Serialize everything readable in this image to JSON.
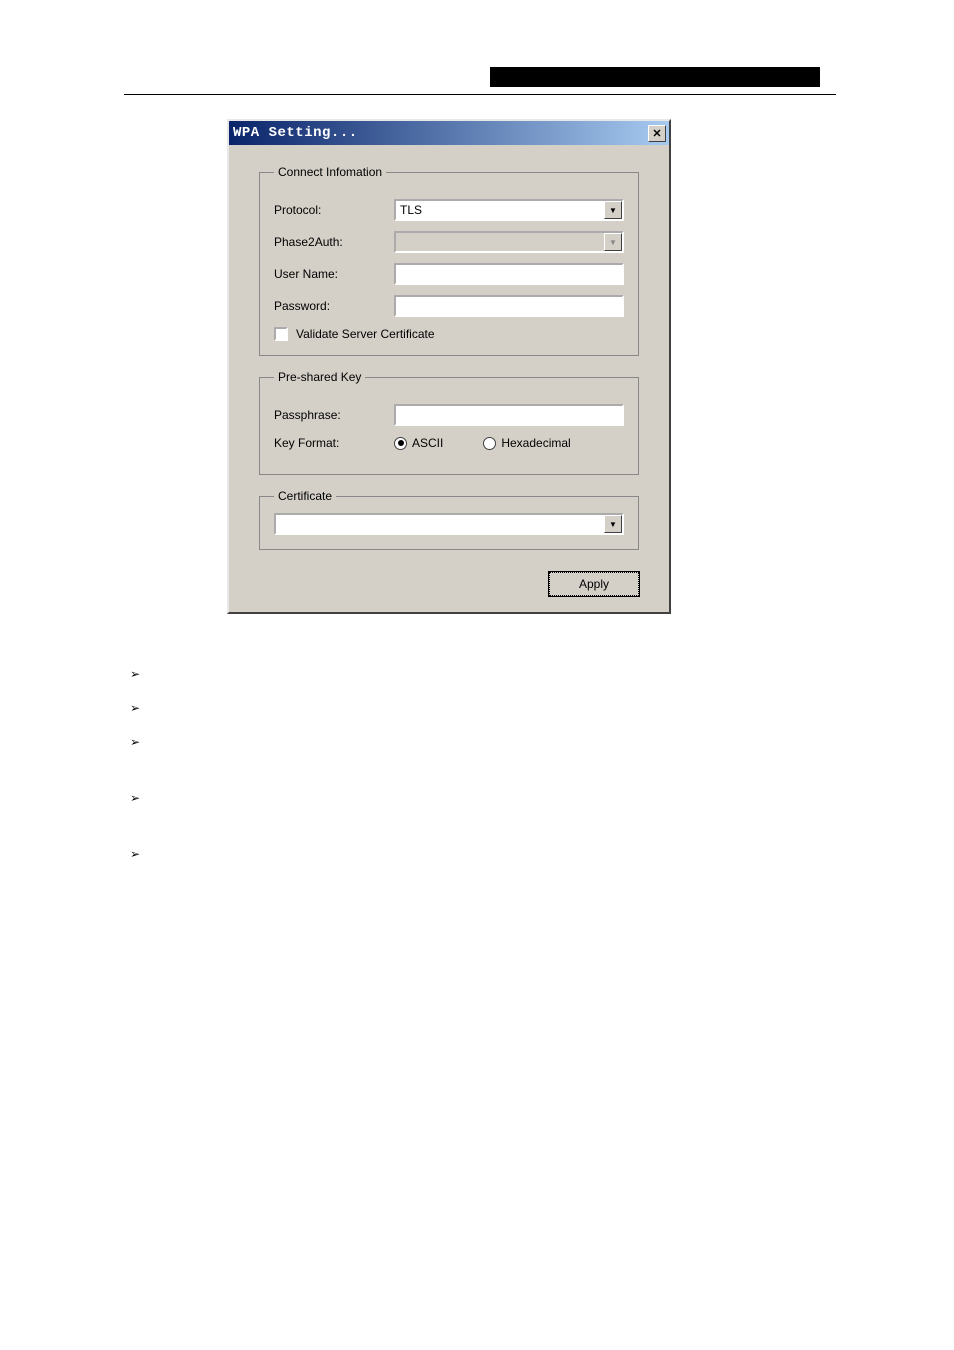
{
  "dialog": {
    "title": "WPA Setting...",
    "group1": {
      "legend": "Connect Infomation",
      "protocol_label": "Protocol:",
      "protocol_value": "TLS",
      "phase2_label": "Phase2Auth:",
      "phase2_value": "",
      "username_label": "User Name:",
      "username_value": "",
      "password_label": "Password:",
      "password_value": "",
      "validate_label": "Validate Server Certificate"
    },
    "group2": {
      "legend": "Pre-shared Key",
      "passphrase_label": "Passphrase:",
      "passphrase_value": "",
      "keyformat_label": "Key Format:",
      "radio_ascii": "ASCII",
      "radio_hex": "Hexadecimal"
    },
    "group3": {
      "legend": "Certificate",
      "cert_value": ""
    },
    "apply_label": "Apply"
  }
}
